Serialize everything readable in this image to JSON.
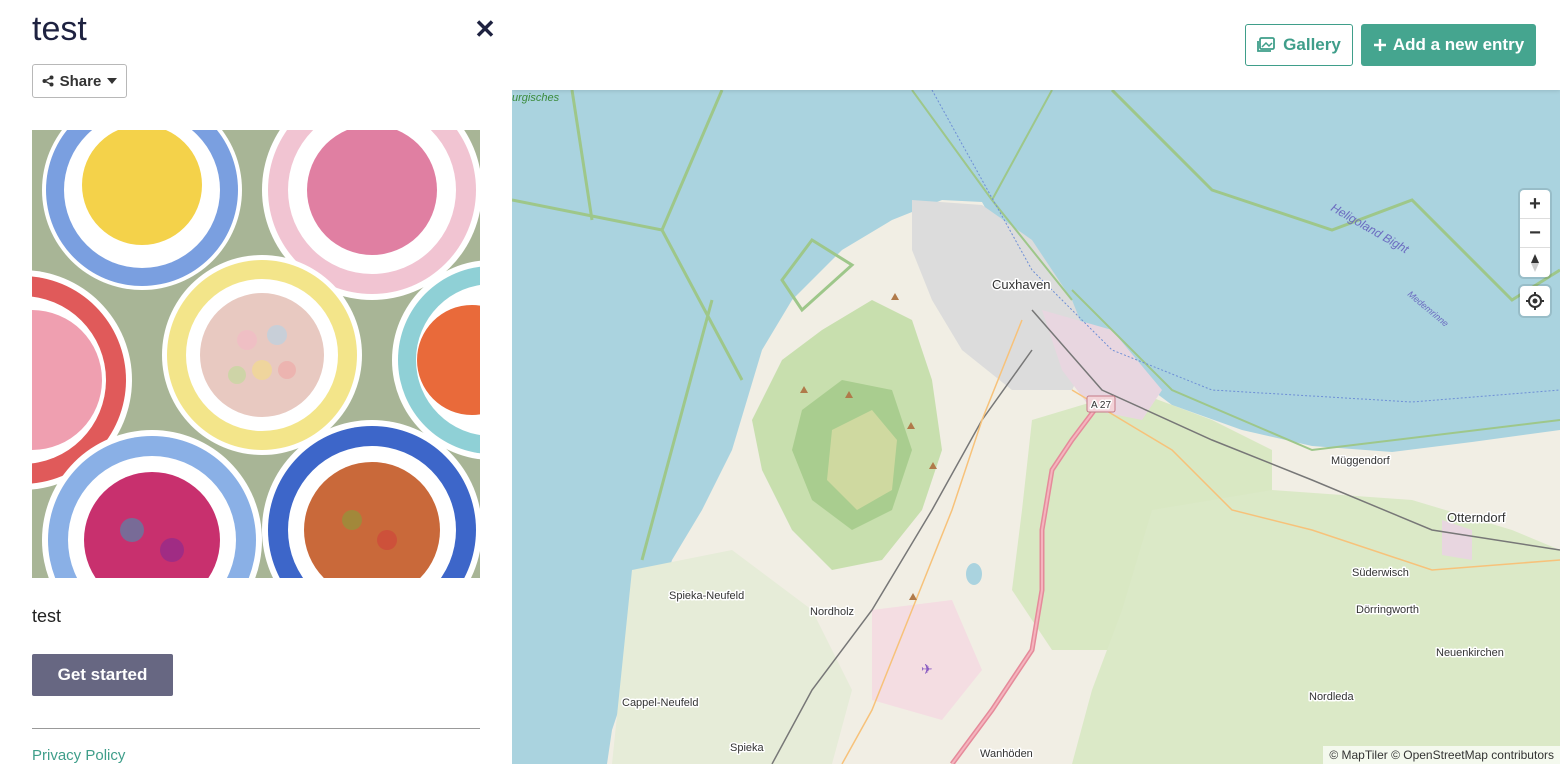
{
  "panel": {
    "title": "test",
    "share_label": "Share",
    "description": "test",
    "cta_label": "Get started",
    "privacy_label": "Privacy Policy"
  },
  "toolbar": {
    "gallery_label": "Gallery",
    "add_entry_label": "Add a new entry"
  },
  "map": {
    "zoom_in": "+",
    "zoom_out": "−",
    "attribution": "© MapTiler © OpenStreetMap contributors",
    "places": {
      "cuxhaven": "Cuxhaven",
      "otterndorf": "Otterndorf",
      "muggendorf": "Müggendorf",
      "suderwisch": "Süderwisch",
      "dorringworth": "Dörringworth",
      "neuenkirchen": "Neuenkirchen",
      "nordleda": "Nordleda",
      "spieka_neufeld": "Spieka-Neufeld",
      "nordholz": "Nordholz",
      "cappel_neufeld": "Cappel-Neufeld",
      "spieka": "Spieka",
      "wanhoden": "Wanhöden",
      "heligoland_bight": "Heligoland Bight",
      "medemrinne": "Medemrinne",
      "hamburgisches": "urgisches",
      "a27": "A 27"
    }
  },
  "colors": {
    "accent": "#45a58f",
    "water": "#aad3df",
    "title": "#1e2240",
    "cta": "#676782"
  },
  "icons": [
    "close-icon",
    "share-icon",
    "caret-down-icon",
    "gallery-icon",
    "plus-icon",
    "compass-icon",
    "locate-icon",
    "airport-icon"
  ]
}
